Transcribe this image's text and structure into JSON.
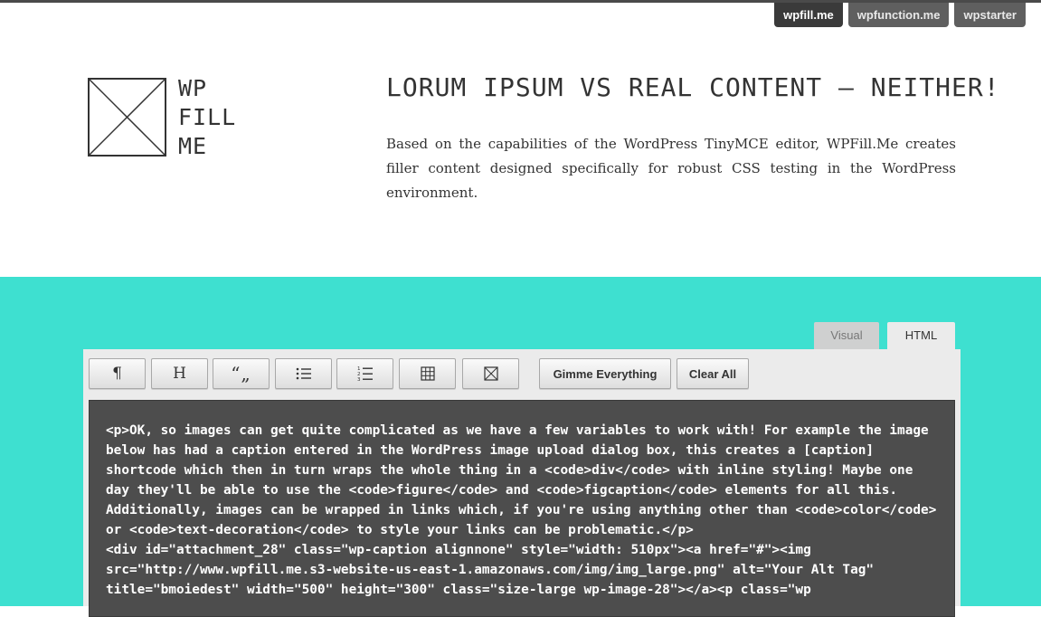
{
  "site_nav": {
    "items": [
      {
        "label": "wpfill.me",
        "active": true
      },
      {
        "label": "wpfunction.me",
        "active": false
      },
      {
        "label": "wpstarter",
        "active": false
      }
    ]
  },
  "logo": {
    "lines": [
      "WP",
      "FILL",
      "ME"
    ],
    "icon": "image-placeholder-icon"
  },
  "hero": {
    "title": "LORUM IPSUM VS REAL CONTENT — NEITHER!",
    "description": "Based on the capabilities of the WordPress TinyMCE editor, WPFill.Me creates filler content designed specifically for robust CSS testing in the WordPress environment."
  },
  "editor": {
    "tabs": [
      {
        "label": "Visual",
        "active": false
      },
      {
        "label": "HTML",
        "active": true
      }
    ],
    "toolbar": {
      "paragraph_glyph": "¶",
      "heading_glyph": "H",
      "quote_glyph": "“„",
      "gimme_label": "Gimme Everything",
      "clear_label": "Clear All"
    },
    "code": "<p>OK, so images can get quite complicated as we have a few variables to work with! For example the image below has had a caption entered in the WordPress image upload dialog box, this creates a [caption] shortcode which then in turn wraps the whole thing in a <code>div</code> with inline styling! Maybe one day they'll be able to use the <code>figure</code> and <code>figcaption</code> elements for all this. Additionally, images can be wrapped in links which, if you're using anything other than <code>color</code> or <code>text-decoration</code> to style your links can be problematic.</p>\n<div id=\"attachment_28\" class=\"wp-caption alignnone\" style=\"width: 510px\"><a href=\"#\"><img src=\"http://www.wpfill.me.s3-website-us-east-1.amazonaws.com/img/img_large.png\" alt=\"Your Alt Tag\" title=\"bmoiedest\" width=\"500\" height=\"300\" class=\"size-large wp-image-28\"></a><p class=\"wp"
  },
  "colors": {
    "accent": "#3ee0d0",
    "code_bg": "#4d4d4d"
  }
}
